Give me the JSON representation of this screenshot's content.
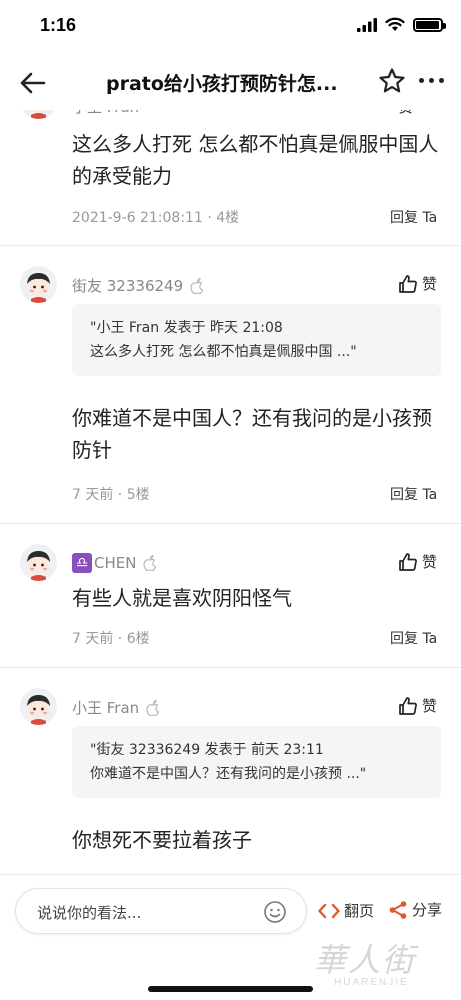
{
  "status_bar": {
    "time": "1:16"
  },
  "nav": {
    "title": "prato给小孩打预防针怎..."
  },
  "comments": [
    {
      "username": "小王 Fran",
      "like_label": "赞",
      "content": "这么多人打死 怎么都不怕真是佩服中国人的承受能力",
      "meta": "2021-9-6 21:08:11 · 4楼",
      "reply_label": "回复 Ta"
    },
    {
      "username": "街友 32336249",
      "like_label": "赞",
      "quote_line1": "\"小王 Fran 发表于 昨天 21:08",
      "quote_line2": "这么多人打死 怎么都不怕真是佩服中国 ...\"",
      "content": "你难道不是中国人？还有我问的是小孩预防针",
      "meta": "7 天前 · 5楼",
      "reply_label": "回复 Ta"
    },
    {
      "badge": "♎",
      "username": "CHEN",
      "like_label": "赞",
      "content": "有些人就是喜欢阴阳怪气",
      "meta": "7 天前 · 6楼",
      "reply_label": "回复 Ta"
    },
    {
      "username": "小王 Fran",
      "like_label": "赞",
      "quote_line1": "\"街友 32336249 发表于 前天 23:11",
      "quote_line2": "你难道不是中国人？还有我问的是小孩预 ...\"",
      "content": "你想死不要拉着孩子"
    }
  ],
  "bottom_bar": {
    "placeholder": "说说你的看法...",
    "flip_label": "翻页",
    "share_label": "分享",
    "watermark_brand": "華人街",
    "watermark_sub": "HUARENJIE"
  },
  "colors": {
    "accent": "#e0572d",
    "badge_purple": "#8a4fbf"
  }
}
